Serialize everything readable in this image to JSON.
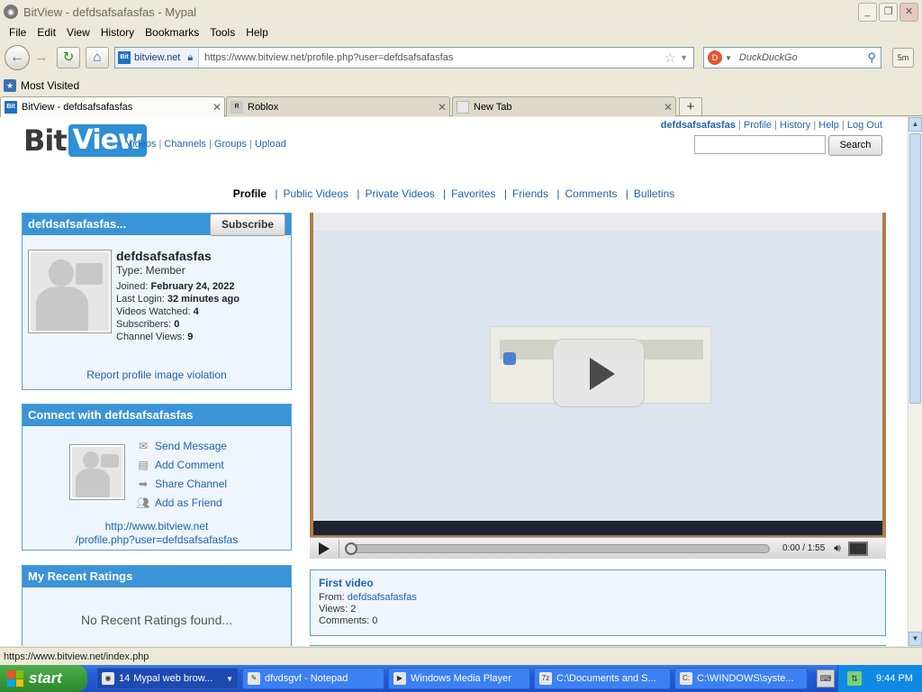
{
  "window": {
    "title": "BitView - defdsafsafasfas - Mypal",
    "app_icon": "mypal-icon",
    "buttons": [
      "_",
      "❐",
      "✕"
    ]
  },
  "menu": [
    "File",
    "Edit",
    "View",
    "History",
    "Bookmarks",
    "Tools",
    "Help"
  ],
  "navbar": {
    "site_domain": "bitview.net",
    "url": "https://www.bitview.net/profile.php?user=defdsafsafasfas",
    "search_placeholder": "DuckDuckGo",
    "addon_label": "5m"
  },
  "bookmarks": {
    "most_visited": "Most Visited"
  },
  "tabs": [
    {
      "label": "BitView - defdsafsafasfas",
      "active": true
    },
    {
      "label": "Roblox",
      "active": false
    },
    {
      "label": "New Tab",
      "active": false
    }
  ],
  "page": {
    "logo": {
      "part1": "Bit",
      "part2": "View"
    },
    "site_nav": [
      "Videos",
      "Channels",
      "Groups",
      "Upload"
    ],
    "user_links": {
      "username": "defdsafsafasfas",
      "links": [
        "Profile",
        "History",
        "Help",
        "Log Out"
      ]
    },
    "search_button": "Search",
    "profile_tabs": [
      "Profile",
      "Public Videos",
      "Private Videos",
      "Favorites",
      "Friends",
      "Comments",
      "Bulletins"
    ],
    "profile_panel": {
      "header": "defdsafsafasfas...",
      "subscribe": "Subscribe",
      "name": "defdsafsafasfas",
      "type": "Type: Member",
      "joined_label": "Joined:",
      "joined_value": "February 24, 2022",
      "last_login_label": "Last Login:",
      "last_login_value": "32 minutes ago",
      "videos_watched_label": "Videos Watched:",
      "videos_watched_value": "4",
      "subscribers_label": "Subscribers:",
      "subscribers_value": "0",
      "channel_views_label": "Channel Views:",
      "channel_views_value": "9",
      "report": "Report profile image violation"
    },
    "connect_panel": {
      "header": "Connect with defdsafsafasfas",
      "actions": [
        "Send Message",
        "Add Comment",
        "Share Channel",
        "Add as Friend"
      ],
      "url_line1": "http://www.bitview.net",
      "url_line2": "/profile.php?user=defdsafsafasfas"
    },
    "ratings_panel": {
      "header": "My Recent Ratings",
      "empty": "No Recent Ratings found..."
    },
    "player": {
      "time": "0:00 / 1:55"
    },
    "video_info": {
      "title": "First video",
      "from_label": "From:",
      "from_user": "defdsafsafasfas",
      "views": "Views: 2",
      "comments": "Comments: 0"
    }
  },
  "status": {
    "text": "https://www.bitview.net/index.php"
  },
  "taskbar": {
    "start": "start",
    "items": [
      {
        "count": "14",
        "label": "Mypal web brow...",
        "icon": "mypal-icon"
      },
      {
        "label": "dfvdsgvf - Notepad",
        "icon": "notepad-icon"
      },
      {
        "label": "Windows Media Player",
        "icon": "media-player-icon"
      },
      {
        "label": "C:\\Documents and S...",
        "icon": "7zip-icon"
      },
      {
        "label": "C:\\WINDOWS\\syste...",
        "icon": "cmd-icon"
      }
    ],
    "clock": "9:44 PM"
  }
}
